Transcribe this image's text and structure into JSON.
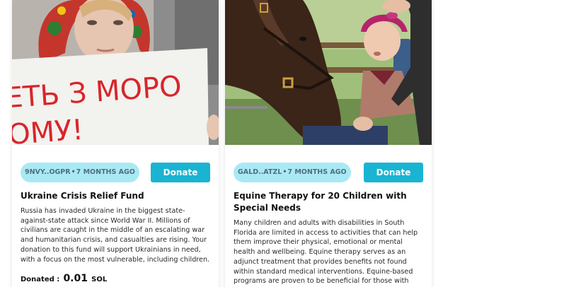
{
  "campaigns": [
    {
      "owner": "9NVY..OGPR",
      "separator": "•",
      "age": "7 MONTHS AGO",
      "donate_label": "Donate",
      "title": "Ukraine Crisis Relief Fund",
      "description": "Russia has invaded Ukraine in the biggest state-against-state attack since World War II. Millions of civilians are caught in the middle of an escalating war and humanitarian crisis, and casualties are rising. Your donation to this fund will support Ukrainians in need, with a focus on the most vulnerable, including children.",
      "donated_label": "Donated :",
      "donated_amount": "0.01",
      "donated_unit": "SOL",
      "sign_text_line1": "ЕТЬ З МОРО",
      "sign_text_line2": "ОМУ!"
    },
    {
      "owner": "GALD..ATZL",
      "separator": "•",
      "age": "7 MONTHS AGO",
      "donate_label": "Donate",
      "title": "Equine Therapy for 20 Children with Special Needs",
      "description": "Many children and adults with disabilities in South Florida are limited in access to activities that can help them improve their physical, emotional or mental health and wellbeing. Equine therapy serves as an adjunct treatment that provides benefits not found within standard medical interventions. Equine-based programs are proven to be beneficial for those with disabilities, helping with mobility"
    }
  ],
  "colors": {
    "badge_bg": "#a9e9f5",
    "button_bg": "#19b4d2"
  }
}
